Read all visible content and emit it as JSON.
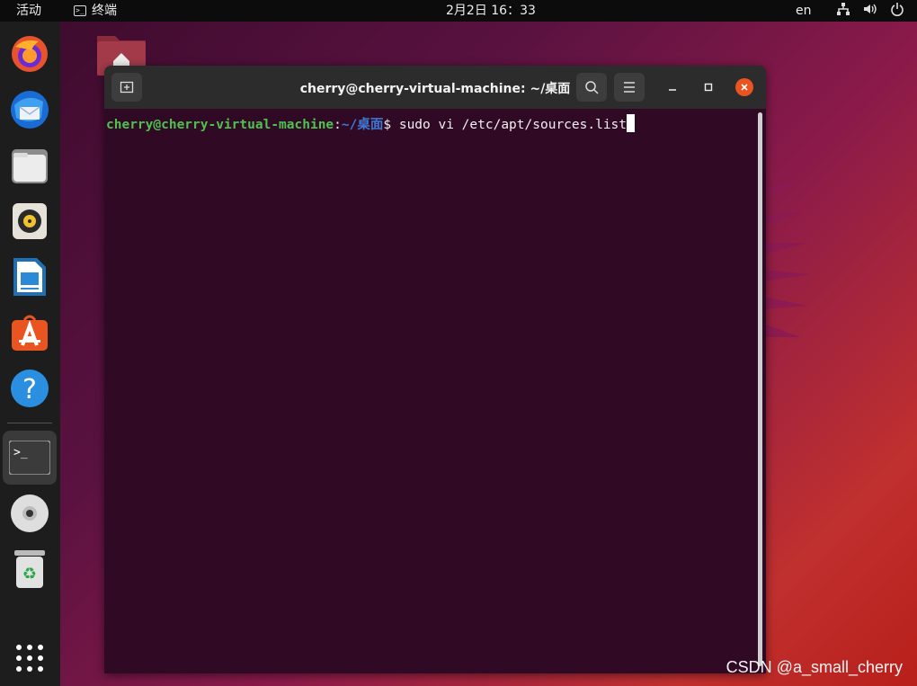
{
  "topbar": {
    "activities": "活动",
    "app_name": "终端",
    "clock": "2月2日  16：33",
    "lang": "en"
  },
  "dock": {
    "items": [
      {
        "name": "firefox-icon"
      },
      {
        "name": "thunderbird-icon"
      },
      {
        "name": "files-icon"
      },
      {
        "name": "rhythmbox-icon"
      },
      {
        "name": "libreoffice-writer-icon"
      },
      {
        "name": "app-center-icon"
      },
      {
        "name": "help-icon"
      },
      {
        "name": "terminal-icon"
      },
      {
        "name": "dvd-icon"
      },
      {
        "name": "trash-icon"
      },
      {
        "name": "show-apps-icon"
      }
    ],
    "terminal_glyph": ">_"
  },
  "terminal": {
    "title": "cherry@cherry-virtual-machine: ~/桌面",
    "prompt_user": "cherry@cherry-virtual-machine",
    "prompt_sep": ":",
    "prompt_path": "~/桌面",
    "prompt_symbol": "$ ",
    "command": "sudo vi /etc/apt/sources.list"
  },
  "watermark": "CSDN @a_small_cherry",
  "colors": {
    "accent": "#e95420",
    "terminal_bg": "#300a24",
    "prompt_user": "#4ec24e",
    "prompt_path": "#3f77d3"
  }
}
